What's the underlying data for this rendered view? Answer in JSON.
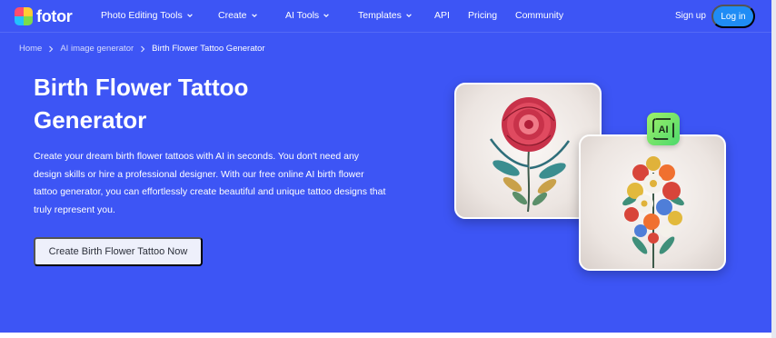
{
  "brand": {
    "name": "fotor"
  },
  "nav": {
    "items": [
      {
        "label": "Photo Editing Tools",
        "has_dropdown": true
      },
      {
        "label": "Create",
        "has_dropdown": true
      },
      {
        "label": "AI Tools",
        "has_dropdown": true
      },
      {
        "label": "Templates",
        "has_dropdown": true
      },
      {
        "label": "API",
        "has_dropdown": false
      },
      {
        "label": "Pricing",
        "has_dropdown": false
      },
      {
        "label": "Community",
        "has_dropdown": false
      }
    ],
    "signup_label": "Sign up",
    "login_label": "Log in"
  },
  "breadcrumb": {
    "items": [
      "Home",
      "AI image generator",
      "Birth Flower Tattoo Generator"
    ]
  },
  "hero": {
    "title": "Birth Flower Tattoo Generator",
    "description": "Create your dream birth flower tattoos with AI in seconds. You don't need any design skills or hire a professional designer. With our free online AI birth flower tattoo generator, you can effortlessly create beautiful and unique tattoo designs that truly represent you.",
    "cta_label": "Create Birth Flower Tattoo Now",
    "badge_text": "AI"
  },
  "colors": {
    "background": "#3d55f5",
    "login_button": "#1f8cf5",
    "cta_background": "#eef0fb",
    "badge_green": "#7be86a"
  },
  "icons": {
    "chevron": "chevron-down-icon",
    "breadcrumb_separator": "chevron-right-icon",
    "ai_badge": "ai-image-icon"
  }
}
